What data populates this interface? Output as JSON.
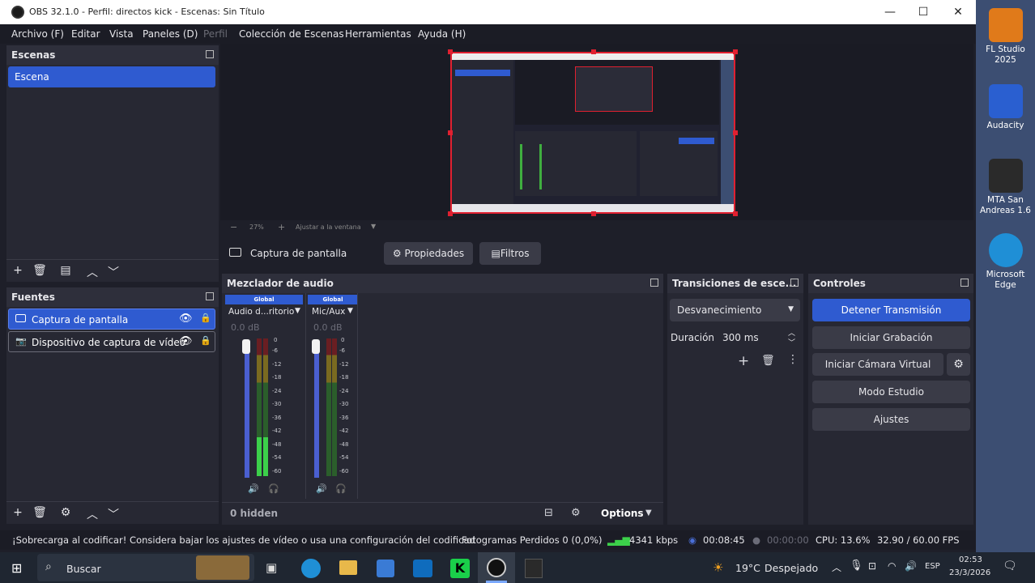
{
  "window": {
    "title": "OBS 32.1.0 - Perfil: directos kick - Escenas: Sin Título",
    "minimize": "—",
    "maximize": "☐",
    "close": "✕"
  },
  "menu": [
    "Archivo (F)",
    "Editar",
    "Vista",
    "Paneles (D)",
    "Perfil",
    "Colección de Escenas",
    "Herramientas",
    "Ayuda (H)"
  ],
  "scenes": {
    "title": "Escenas",
    "items": [
      "Escena"
    ]
  },
  "sources": {
    "title": "Fuentes",
    "items": [
      "Captura de pantalla",
      "Dispositivo de captura de vídeo"
    ]
  },
  "preview": {
    "zoom": "27%",
    "fit_label": "Ajustar a la ventana"
  },
  "source_bar": {
    "source_name": "Captura de pantalla",
    "properties": "Propiedades",
    "filters": "Filtros"
  },
  "mixer": {
    "title": "Mezclador de audio",
    "channels": [
      {
        "tag": "Global",
        "name": "Audio d...ritorio",
        "db": "0.0 dB"
      },
      {
        "tag": "Global",
        "name": "Mic/Aux",
        "db": "0.0 dB"
      }
    ],
    "ticks": [
      "0",
      "-6",
      "-12",
      "-18",
      "-24",
      "-30",
      "-36",
      "-42",
      "-48",
      "-54",
      "-60"
    ],
    "hidden": "0 hidden",
    "options": "Options"
  },
  "transitions": {
    "title": "Transiciones de esce...",
    "type": "Desvanecimiento",
    "duration_label": "Duración",
    "duration_value": "300 ms"
  },
  "controls": {
    "title": "Controles",
    "stop_stream": "Detener Transmisión",
    "start_record": "Iniciar Grabación",
    "virtual_cam": "Iniciar Cámara Virtual",
    "studio_mode": "Modo Estudio",
    "settings": "Ajustes"
  },
  "status": {
    "warning": "¡Sobrecarga al codificar! Considera bajar los ajustes de vídeo o usa una configuración del codificad",
    "dropped": "Fotogramas Perdidos 0 (0,0%)",
    "bitrate": "4341 kbps",
    "stream_time": "00:08:45",
    "rec_time": "00:00:00",
    "cpu": "CPU: 13.6%",
    "fps": "32.90 / 60.00 FPS"
  },
  "taskbar": {
    "search": "Buscar",
    "weather_temp": "19°C",
    "weather_desc": "Despejado",
    "lang": "ESP",
    "time": "02:53",
    "date": "23/3/2026"
  },
  "desktop_icons": [
    {
      "label": "FL Studio 2025",
      "color": "#e07a1a"
    },
    {
      "label": "Audacity",
      "color": "#2a5fd0"
    },
    {
      "label": "MTA San Andreas 1.6",
      "color": "#2a2a2a"
    },
    {
      "label": "Microsoft Edge",
      "color": "#1f8fd6"
    }
  ]
}
